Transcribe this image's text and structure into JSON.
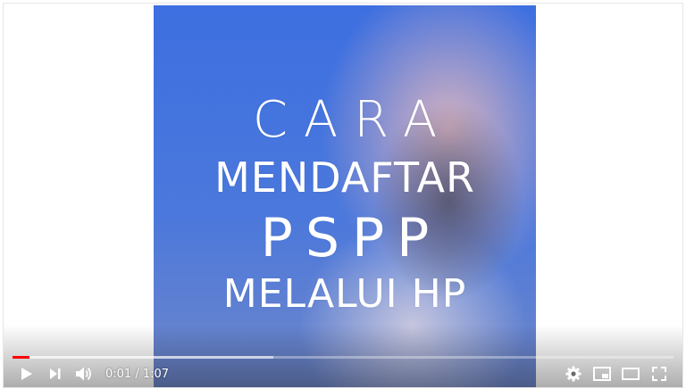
{
  "video": {
    "title_lines": [
      "CARA",
      "MENDAFTAR",
      "PSPP",
      "MELALUI HP"
    ]
  },
  "progress": {
    "played_fraction": 0.025,
    "buffered_fraction": 0.395
  },
  "controls": {
    "current_time": "0:01",
    "duration": "1:07",
    "separator": " / ",
    "icons": [
      "play-icon",
      "next-icon",
      "volume-icon",
      "settings-icon",
      "miniplayer-icon",
      "theater-mode-icon",
      "fullscreen-icon"
    ]
  },
  "colors": {
    "played": "#ff0000",
    "video_blue": "#4b78dc"
  }
}
